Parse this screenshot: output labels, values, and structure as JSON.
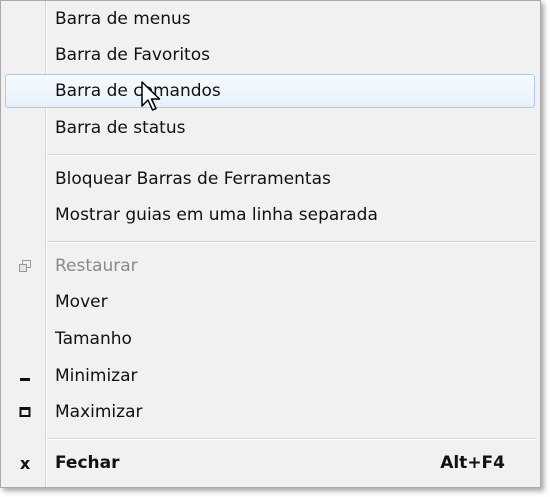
{
  "menu": {
    "group1": [
      {
        "label": "Barra de menus"
      },
      {
        "label": "Barra de Favoritos"
      },
      {
        "label": "Barra de comandos"
      },
      {
        "label": "Barra de status"
      }
    ],
    "group2": [
      {
        "label": "Bloquear Barras de Ferramentas"
      },
      {
        "label": "Mostrar guias em uma linha separada"
      }
    ],
    "group3": [
      {
        "label": "Restaurar",
        "icon": "restore-icon",
        "disabled": true
      },
      {
        "label": "Mover"
      },
      {
        "label": "Tamanho"
      },
      {
        "label": "Minimizar",
        "icon": "minimize-icon"
      },
      {
        "label": "Maximizar",
        "icon": "maximize-icon"
      }
    ],
    "close": {
      "label": "Fechar",
      "shortcut": "Alt+F4",
      "icon": "close-icon"
    }
  },
  "colors": {
    "menu_bg": "#f1f1f1",
    "hover_border": "#b2cbe6",
    "disabled_text": "#8a8a8a"
  }
}
